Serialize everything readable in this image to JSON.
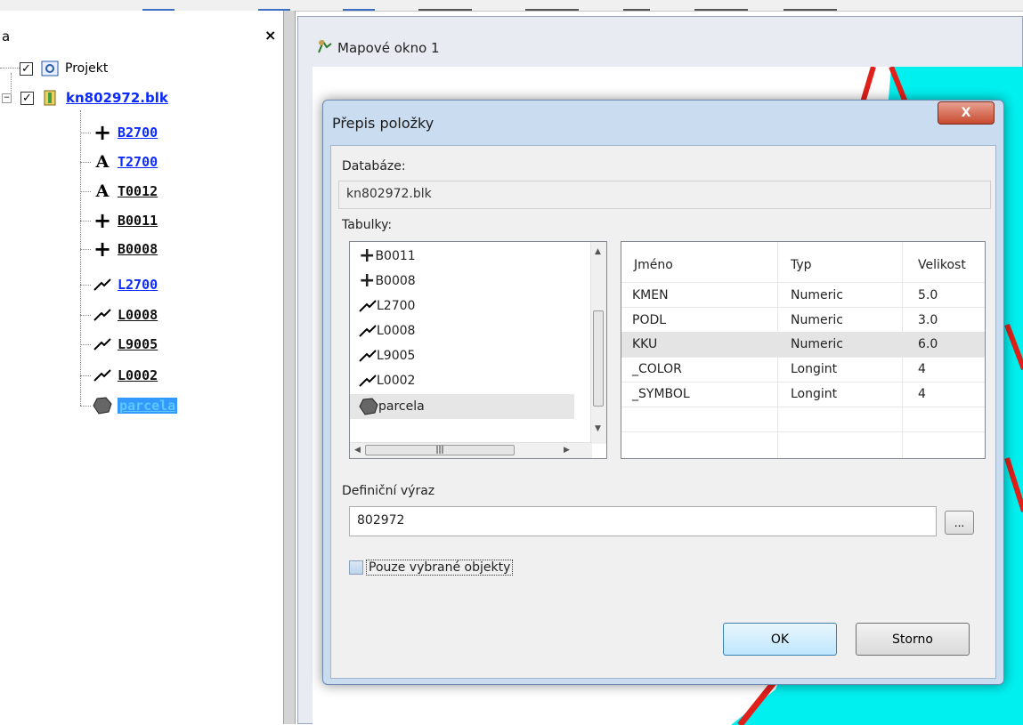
{
  "tree_panel": {
    "header_title": "a",
    "close_label": "×",
    "root": {
      "label": "Projekt",
      "checked": true,
      "icon": "project-icon"
    },
    "layer": {
      "label": "kn802972.blk",
      "checked": true,
      "icon": "layer-book-icon"
    },
    "items": [
      {
        "label": "B2700",
        "symbol": "point-plus-icon",
        "color": "blue"
      },
      {
        "label": "T2700",
        "symbol": "text-a-icon",
        "color": "blue"
      },
      {
        "label": "T0012",
        "symbol": "text-a-icon",
        "color": "dark"
      },
      {
        "label": "B0011",
        "symbol": "point-plus-icon",
        "color": "dark"
      },
      {
        "label": "B0008",
        "symbol": "point-plus-icon",
        "color": "dark"
      },
      {
        "label": "L2700",
        "symbol": "line-icon",
        "color": "blue"
      },
      {
        "label": "L0008",
        "symbol": "line-icon",
        "color": "dark"
      },
      {
        "label": "L9005",
        "symbol": "line-icon",
        "color": "dark"
      },
      {
        "label": "L0002",
        "symbol": "line-icon",
        "color": "dark"
      },
      {
        "label": "parcela",
        "symbol": "polygon-icon",
        "color": "selected"
      }
    ]
  },
  "map_window": {
    "title": "Mapové okno 1"
  },
  "dialog": {
    "title": "Přepis položky",
    "close_label": "X",
    "database_label": "Databáze:",
    "database_value": "kn802972.blk",
    "tables_label": "Tabulky:",
    "tables": [
      {
        "label": "B0011",
        "symbol": "point-plus-icon"
      },
      {
        "label": "B0008",
        "symbol": "point-plus-icon"
      },
      {
        "label": "L2700",
        "symbol": "line-icon"
      },
      {
        "label": "L0008",
        "symbol": "line-icon"
      },
      {
        "label": "L9005",
        "symbol": "line-icon"
      },
      {
        "label": "L0002",
        "symbol": "line-icon"
      },
      {
        "label": "parcela",
        "symbol": "polygon-icon",
        "selected": true
      }
    ],
    "fields_columns": [
      "Jméno",
      "Typ",
      "Velikost"
    ],
    "fields_rows": [
      [
        "KMEN",
        "Numeric",
        "5.0"
      ],
      [
        "PODL",
        "Numeric",
        "3.0"
      ],
      [
        "KKU",
        "Numeric",
        "6.0"
      ],
      [
        "_COLOR",
        "Longint",
        "4"
      ],
      [
        "_SYMBOL",
        "Longint",
        "4"
      ]
    ],
    "selected_field_row": 2,
    "expression_label": "Definiční výraz",
    "expression_value": "802972",
    "ellipsis_label": "...",
    "only_selected_label": "Pouze vybrané objekty",
    "only_selected_checked": false,
    "ok_label": "OK",
    "cancel_label": "Storno"
  },
  "colors": {
    "link_blue": "#0a2aff",
    "selection": "#3399ff",
    "map_cyan": "#00f0f0",
    "map_red": "#e0201a",
    "dialog_frame": "#c9dcf0"
  }
}
